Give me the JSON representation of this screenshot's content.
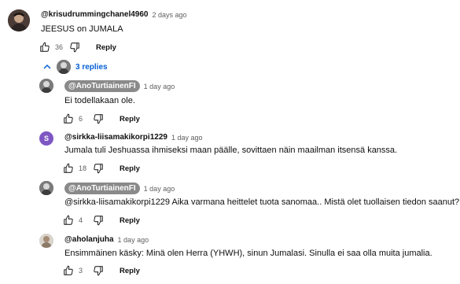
{
  "top_comment": {
    "author": "@krisudrummingchanel4960",
    "time": "2 days ago",
    "text": "JEESUS on JUMALA",
    "likes": "36",
    "reply_label": "Reply"
  },
  "replies_toggle": {
    "label": "3 replies",
    "expanded": true,
    "color": "#065fd4"
  },
  "replies": [
    {
      "author": "@AnoTurtiainenFI",
      "owner": true,
      "time": "1 day ago",
      "text": "Ei todellakaan ole.",
      "likes": "6",
      "reply_label": "Reply"
    },
    {
      "author": "@sirkka-liisamakikorpi1229",
      "avatar_letter": "S",
      "avatar_color": "#7e57c2",
      "time": "1 day ago",
      "text": "Jumala tuli Jeshuassa ihmiseksi maan päälle, sovittaen näin maailman itsensä kanssa.",
      "likes": "18",
      "reply_label": "Reply"
    },
    {
      "author": "@AnoTurtiainenFI",
      "owner": true,
      "time": "1 day ago",
      "text": "@sirkka-liisamakikorpi1229 Aika varmana heittelet tuota sanomaa.. Mistä olet tuollaisen tiedon saanut?",
      "likes": "4",
      "reply_label": "Reply"
    },
    {
      "author": "@aholanjuha",
      "time": "1 day ago",
      "text": "Ensimmäinen käsky: Minä olen Herra (YHWH), sinun Jumalasi. Sinulla ei saa olla muita jumalia.",
      "likes": "3",
      "reply_label": "Reply"
    }
  ]
}
